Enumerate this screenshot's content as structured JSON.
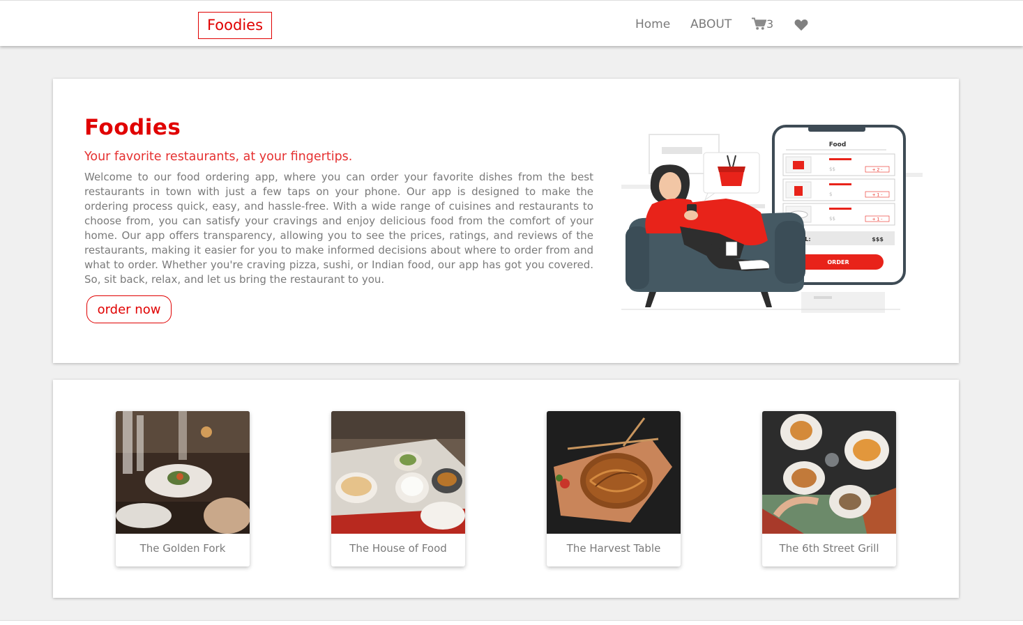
{
  "navbar": {
    "brand": "Foodies",
    "links": [
      "Home",
      "ABOUT"
    ],
    "cart_icon": "shopping-cart-icon",
    "cart_count": "3",
    "favorites_icon": "heart-icon"
  },
  "hero": {
    "title": "Foodies",
    "subtitle": "Your favorite restaurants, at your fingertips.",
    "description": "Welcome to our food ordering app, where you can order your favorite dishes from the best restaurants in town with just a few taps on your phone. Our app is designed to make the ordering process quick, easy, and hassle-free. With a wide range of cuisines and restaurants to choose from, you can satisfy your cravings and enjoy delicious food from the comfort of your home. Our app offers transparency, allowing you to see the prices, ratings, and reviews of the restaurants, making it easier for you to make informed decisions about where to order from and what to order. Whether you're craving pizza, sushi, or Indian food, our app has got you covered. So, sit back, relax, and let us bring the restaurant to you.",
    "button_label": "order now",
    "illustration": {
      "phone_header": "Food",
      "total_label": "TOTAL:",
      "total_value": "$$$",
      "order_label": "ORDER",
      "price_a": "$$",
      "price_b": "$",
      "qty_a": "+ 2 -",
      "qty_b": "+ 1 -"
    }
  },
  "restaurants": [
    {
      "name": "The Golden Fork"
    },
    {
      "name": "The House of Food"
    },
    {
      "name": "The Harvest Table"
    },
    {
      "name": "The 6th Street Grill"
    }
  ],
  "colors": {
    "accent": "#e00000",
    "text_muted": "#7a7a7a",
    "background": "#f0f0f0"
  }
}
